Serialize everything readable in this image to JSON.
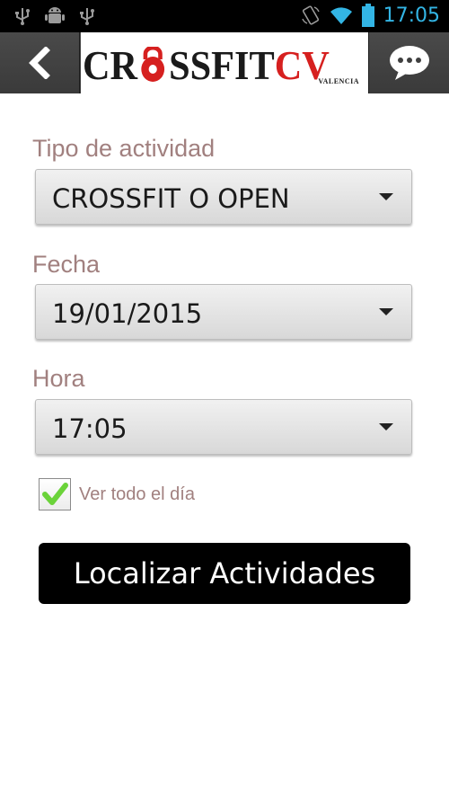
{
  "status_bar": {
    "time": "17:05",
    "icons": [
      "usb-icon",
      "android-debug-icon",
      "usb-icon",
      "rotate-icon",
      "wifi-icon",
      "battery-icon"
    ]
  },
  "app_bar": {
    "logo_text_start": "CR",
    "logo_text_middle": "SSFIT",
    "logo_text_end": "CV",
    "logo_subtitle": "VALENCIA",
    "accent_color": "#d6201f",
    "back_icon": "chevron-left-icon",
    "chat_icon": "chat-bubble-icon"
  },
  "form": {
    "activity_label": "Tipo de actividad",
    "activity_value": "CROSSFIT O OPEN",
    "date_label": "Fecha",
    "date_value": "19/01/2015",
    "time_label": "Hora",
    "time_value": "17:05",
    "all_day_label": "Ver todo el día",
    "all_day_checked": true,
    "submit_label": "Localizar Actividades"
  }
}
